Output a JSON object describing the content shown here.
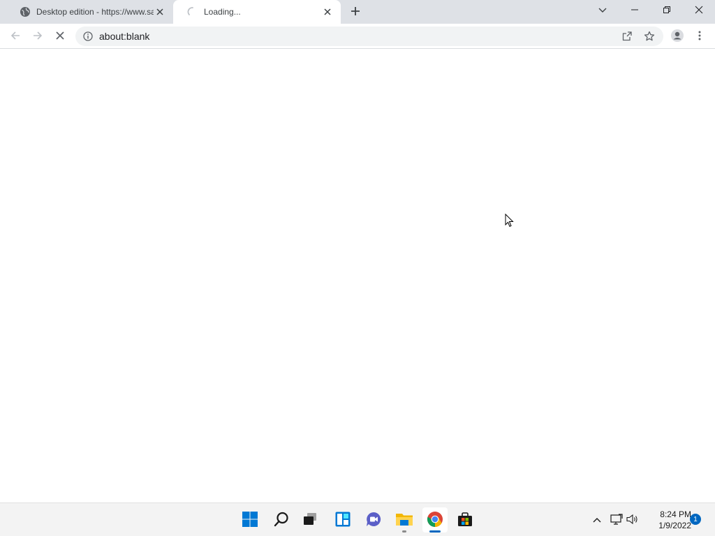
{
  "browser": {
    "tabs": [
      {
        "title": "Desktop edition - https://www.sa",
        "favicon": "globe-icon",
        "active": false
      },
      {
        "title": "Loading...",
        "favicon": "loading-spinner-icon",
        "active": true
      }
    ],
    "address_bar": {
      "url": "about:blank"
    },
    "icons": {
      "back": "arrow-left-icon",
      "forward": "arrow-right-icon",
      "stop": "close-icon",
      "site_info": "info-icon",
      "share": "share-icon",
      "bookmark": "star-icon",
      "profile": "person-icon",
      "menu": "kebab-menu-icon",
      "tab_search": "chevron-down-icon",
      "new_tab": "plus-icon",
      "minimize": "minimize-icon",
      "restore": "restore-icon",
      "close_window": "close-icon"
    }
  },
  "taskbar": {
    "apps": [
      "windows-start-icon",
      "search-icon",
      "task-view-icon",
      "widgets-icon",
      "teams-chat-icon",
      "file-explorer-icon",
      "chrome-icon",
      "store-icon"
    ],
    "tray_icons": [
      "chevron-up-icon",
      "network-icon",
      "volume-icon"
    ],
    "clock": {
      "time": "8:24 PM",
      "date": "1/9/2022"
    },
    "notifications": {
      "count": "1"
    }
  },
  "colors": {
    "tabstrip": "#dee1e6",
    "omnibox": "#f1f3f4",
    "accent": "#0067c0"
  }
}
